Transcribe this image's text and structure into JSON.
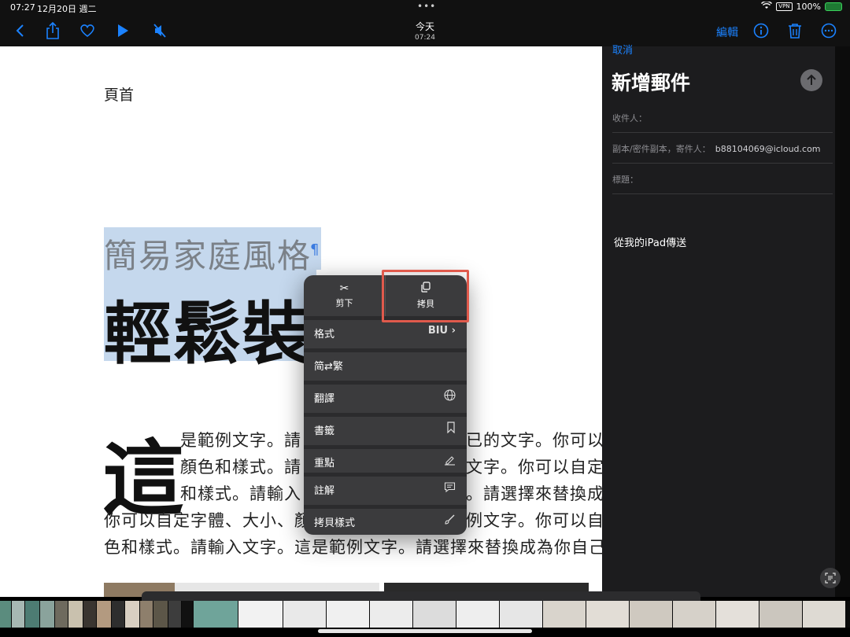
{
  "status_bar": {
    "time": "07:27",
    "date": "12月20日 週二",
    "dots": "•••",
    "vpn": "VPN",
    "battery": "100%"
  },
  "toolbar": {
    "title": "今天",
    "subtitle": "07:24",
    "edit_label": "編輯",
    "icons": [
      "back-chevron-icon",
      "share-icon",
      "heart-icon",
      "play-icon",
      "mute-icon",
      "info-icon",
      "trash-icon",
      "more-icon"
    ]
  },
  "document": {
    "header": "頁首",
    "subtitle": "簡易家庭風格",
    "pilcrow": "¶",
    "title": "輕鬆裝飾",
    "dropcap": "這",
    "lines": [
      "是範例文字。請",
      "已的文字。你可以",
      "顏色和樣式。請",
      "文字。你可以自定",
      "和樣式。請輸入",
      "。請選擇來替換成",
      "你可以自定字體、大小、顏",
      "例文字。你可以自",
      "色和樣式。請輸入文字。這是範例文字。請選擇來替換成為你自己"
    ]
  },
  "context_menu": {
    "cut": "剪下",
    "copy": "拷貝",
    "items": [
      {
        "label": "格式",
        "trail": "BIU ›"
      },
      {
        "label": "简⇄繁",
        "trail": ""
      },
      {
        "label": "翻譯",
        "trail": "🌐"
      },
      {
        "label": "書籤",
        "trail": "🔖"
      },
      {
        "label": "重點",
        "trail": "✎"
      },
      {
        "label": "註解",
        "trail": "💬"
      },
      {
        "label": "拷貝樣式",
        "trail": "🖌"
      }
    ]
  },
  "mail": {
    "cancel": "取消",
    "heading": "新增郵件",
    "to_label": "收件人：",
    "cc_label": "副本/密件副本，寄件人：",
    "from_value": "b88104069@icloud.com",
    "subject_label": "標題：",
    "signature": "從我的iPad傳送"
  },
  "colors": {
    "accent": "#1b82ff",
    "selection": "#c5d8ed",
    "highlight_box": "#e05a4c"
  }
}
